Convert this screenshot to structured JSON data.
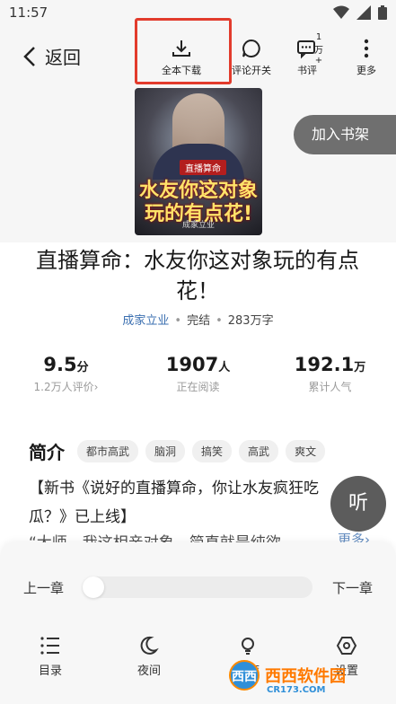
{
  "status_bar": {
    "time": "11:57"
  },
  "toolbar": {
    "back_label": "返回",
    "download_label": "全本下载",
    "comments_label": "评论开关",
    "reviews_label": "书评",
    "reviews_count": "1万+",
    "more_label": "更多"
  },
  "book": {
    "cover_tag": "直播算命",
    "cover_title_line1": "水友你这对象",
    "cover_title_line2": "玩的有点花!",
    "cover_author": "成家立业",
    "add_shelf": "加入书架",
    "title": "直播算命：水友你这对象玩的有点花！",
    "author": "成家立业",
    "status": "完结",
    "word_count": "283万字"
  },
  "stats": [
    {
      "value": "9.5",
      "unit": "分",
      "label": "1.2万人评价›"
    },
    {
      "value": "1907",
      "unit": "人",
      "label": "正在阅读"
    },
    {
      "value": "192.1",
      "unit": "万",
      "label": "累计人气"
    }
  ],
  "intro": {
    "heading": "简介",
    "tags": [
      "都市高武",
      "脑洞",
      "搞笑",
      "高武",
      "爽文"
    ],
    "text": "【新书《说好的直播算命，你让水友疯狂吃瓜？》已上线】",
    "text2": "“大师，我这相亲对象，简直就是纯欲...",
    "more": "更多›",
    "listen": "听"
  },
  "reader": {
    "prev": "上一章",
    "next": "下一章",
    "progress": 0.0,
    "menu": [
      "目录",
      "夜间",
      "亮度",
      "设置"
    ]
  },
  "watermark": {
    "text": "西西软件园",
    "sub": "CR173.COM",
    "logo": "西西"
  },
  "colors": {
    "accent": "#3b6fb0",
    "highlight": "#e23b2c"
  }
}
